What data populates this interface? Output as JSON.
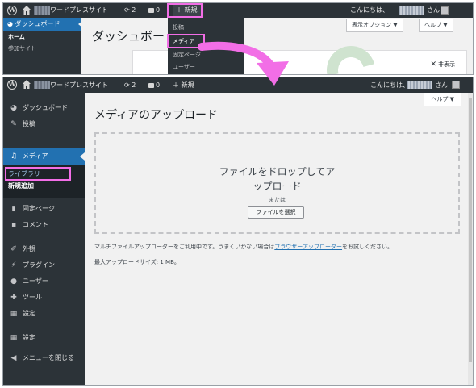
{
  "top_panel": {
    "adminbar": {
      "site_name": "ワードプレスサイト",
      "comments_count": "2",
      "pending_count": "0",
      "new_label": "新規",
      "greeting": "こんにちは、",
      "greeting_suffix": "さん"
    },
    "sidebar": {
      "dashboard": "ダッシュボード",
      "home": "ホーム",
      "joined_sites": "参加サイト"
    },
    "page_title": "ダッシュボード",
    "screen_options": "表示オプション ▼",
    "help": "ヘルプ ▼",
    "dismiss": "非表示",
    "new_menu": [
      "投稿",
      "メディア",
      "固定ページ",
      "ユーザー"
    ]
  },
  "main_panel": {
    "adminbar": {
      "site_name": "ワードプレスサイト",
      "comments_count": "2",
      "pending_count": "0",
      "new_label": "新規",
      "greeting": "こんにちは、",
      "greeting_suffix": "さん"
    },
    "sidebar": {
      "items": [
        {
          "label": "ダッシュボード",
          "icon": "gauge-icon"
        },
        {
          "label": "投稿",
          "icon": "pin-icon"
        },
        {
          "label": "メディア",
          "icon": "media-icon"
        },
        {
          "label": "固定ページ",
          "icon": "page-icon"
        },
        {
          "label": "コメント",
          "icon": "comment-icon"
        },
        {
          "label": "外観",
          "icon": "brush-icon"
        },
        {
          "label": "プラグイン",
          "icon": "plugin-icon"
        },
        {
          "label": "ユーザー",
          "icon": "user-icon"
        },
        {
          "label": "ツール",
          "icon": "wrench-icon"
        },
        {
          "label": "設定",
          "icon": "settings-icon"
        },
        {
          "label": "設定",
          "icon": "settings-icon"
        },
        {
          "label": "メニューを閉じる",
          "icon": "collapse-icon"
        }
      ],
      "submenu": [
        "ライブラリ",
        "新規追加"
      ]
    },
    "page_title": "メディアのアップロード",
    "help": "ヘルプ ▼",
    "dropzone": {
      "line1": "ファイルをドロップしてア",
      "line2": "ップロード",
      "or": "または",
      "select_button": "ファイルを選択"
    },
    "notice_before_link": "マルチファイルアップローダーをご利用中です。うまくいかない場合は",
    "notice_link": "ブラウザーアップローダー",
    "notice_after_link": "をお試しください。",
    "max_size": "最大アップロードサイズ: 1 MB。"
  },
  "colors": {
    "adminbar": "#2c3338",
    "accent": "#2271b1",
    "highlight": "#f26ee6"
  }
}
